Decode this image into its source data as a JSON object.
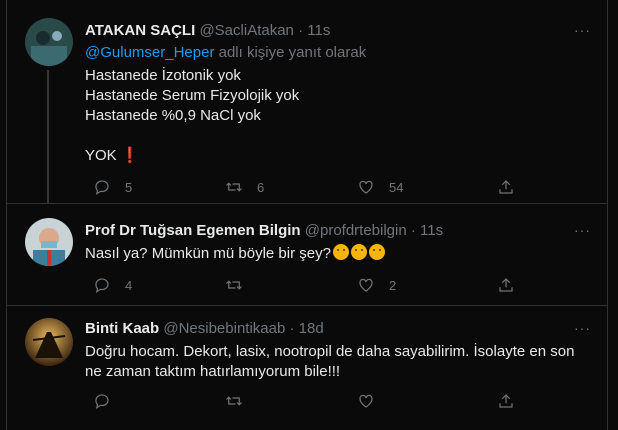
{
  "tweets": [
    {
      "name": "ATAKAN SAÇLI",
      "handle": "@SacliAtakan",
      "sep": "·",
      "time": "11s",
      "reply_mention": "@Gulumser_Heper",
      "reply_suffix": " adlı kişiye yanıt olarak",
      "lines": [
        "Hastanede İzotonik yok",
        "Hastanede Serum Fizyolojik yok",
        "Hastanede %0,9 NaCl yok",
        "",
        "YOK ❗"
      ],
      "reply_count": "5",
      "retweet_count": "6",
      "like_count": "54",
      "more": "···"
    },
    {
      "name": "Prof Dr Tuğsan Egemen Bilgin",
      "handle": "@profdrtebilgin",
      "sep": "·",
      "time": "11s",
      "text": "Nasıl ya? Mümkün mü böyle bir şey?",
      "emoji_name": "thinking-face",
      "reply_count": "4",
      "retweet_count": "",
      "like_count": "2",
      "more": "···"
    },
    {
      "name": "Binti Kaab",
      "handle": "@Nesibebintikaab",
      "sep": "·",
      "time": "18d",
      "text": "Doğru hocam. Dekort, lasix, nootropil de daha sayabilirim. İsolayte en son ne zaman taktım hatırlamıyorum bile!!!",
      "reply_count": "",
      "retweet_count": "",
      "like_count": "",
      "more": "···"
    }
  ],
  "colors": {
    "background": "#0a0a0a",
    "text": "#e7e9ea",
    "muted": "#71767b",
    "link": "#1d9bf0",
    "border": "#2f3336",
    "alert": "#f4212e"
  }
}
